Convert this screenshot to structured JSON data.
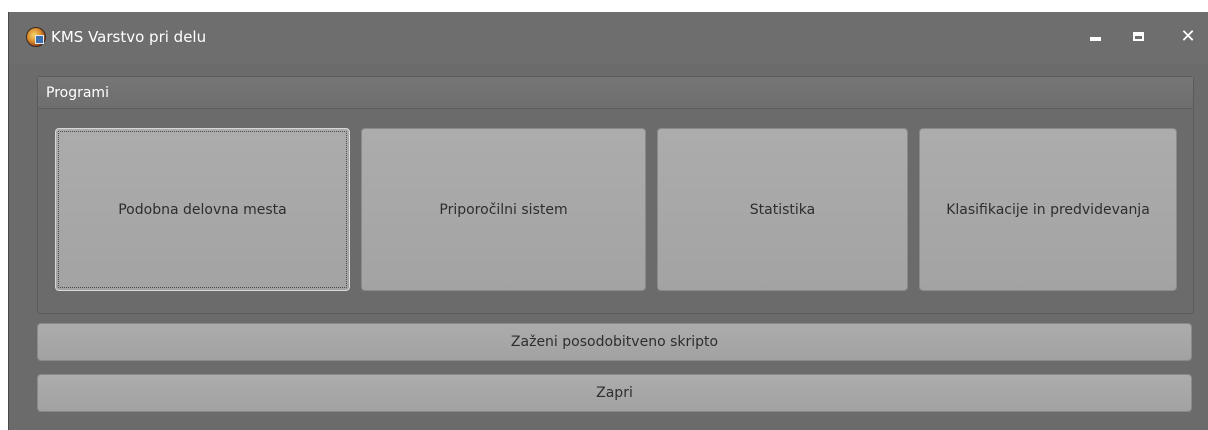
{
  "window": {
    "title": "KMS Varstvo pri delu",
    "icon": "app-logo-icon",
    "controls": {
      "minimize": "minimize-icon",
      "maximize": "maximize-icon",
      "close": "✕"
    }
  },
  "programs": {
    "group_title": "Programi",
    "buttons": [
      {
        "label": "Podobna delovna mesta"
      },
      {
        "label": "Priporočilni sistem"
      },
      {
        "label": "Statistika"
      },
      {
        "label": "Klasifikacije in predvidevanja"
      }
    ]
  },
  "actions": {
    "run_update_script": "Zaženi posodobitveno skripto",
    "close": "Zapri"
  },
  "colors": {
    "window_bg": "#6b6b6b",
    "button_bg": "#a8a8a8",
    "text_light": "#ffffff",
    "text_dark": "#2e2e2e"
  }
}
